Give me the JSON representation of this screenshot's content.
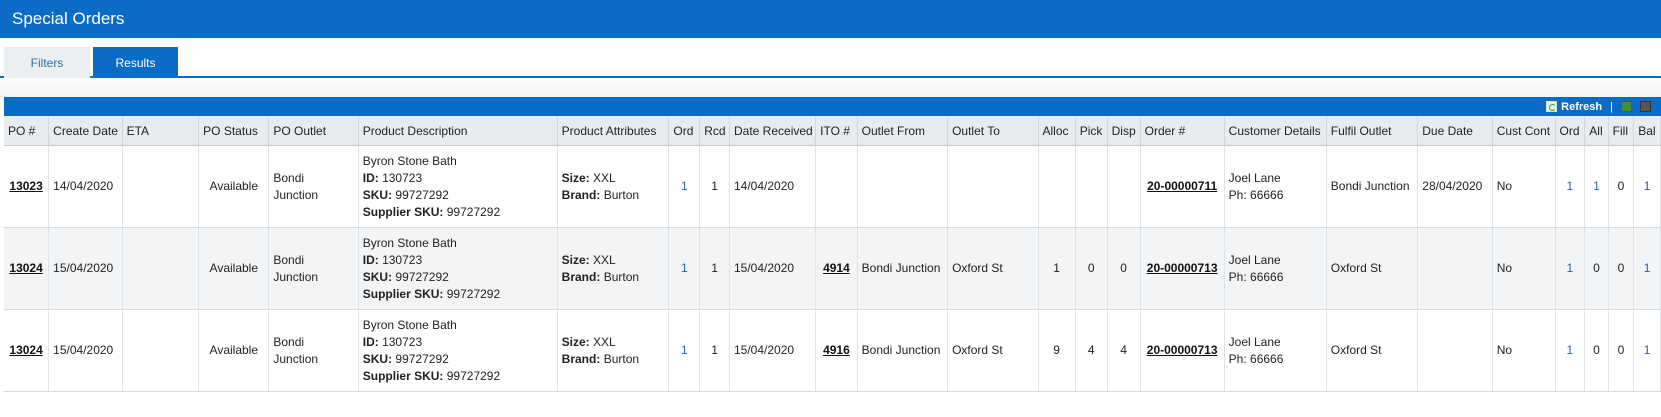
{
  "app": {
    "title": "Special Orders"
  },
  "tabs": {
    "filters": "Filters",
    "results": "Results"
  },
  "toolbar": {
    "refresh": "Refresh",
    "separator": "|"
  },
  "labels": {
    "id": "ID:",
    "sku": "SKU:",
    "supplier_sku": "Supplier SKU:",
    "size": "Size:",
    "brand": "Brand:",
    "phone": "Ph:"
  },
  "columns": [
    "PO #",
    "Create Date",
    "ETA",
    "PO Status",
    "PO Outlet",
    "Product Description",
    "Product Attributes",
    "Ord",
    "Rcd",
    "Date Received",
    "ITO #",
    "Outlet From",
    "Outlet To",
    "Alloc",
    "Pick",
    "Disp",
    "Order #",
    "Customer Details",
    "Fulfil Outlet",
    "Due Date",
    "Cust Cont",
    "Ord",
    "All",
    "Fill",
    "Bal"
  ],
  "rows": [
    {
      "po": "13023",
      "create_date": "14/04/2020",
      "eta": "",
      "po_status": "Available",
      "po_outlet": [
        "Bondi",
        "Junction"
      ],
      "product": {
        "name": "Byron Stone Bath",
        "id": "130723",
        "sku": "99727292",
        "supplier_sku": "99727292"
      },
      "attrs": {
        "size": "XXL",
        "brand": "Burton"
      },
      "ord": "1",
      "rcd": "1",
      "date_received": "14/04/2020",
      "ito": "",
      "outlet_from": "",
      "outlet_to": "",
      "alloc": "",
      "pick": "",
      "disp": "",
      "order": "20-00000711",
      "customer": {
        "name": "Joel Lane",
        "phone": "66666"
      },
      "fulfil_outlet": "Bondi Junction",
      "due_date": "28/04/2020",
      "cust_cont": "No",
      "ord2": "1",
      "all": "1",
      "fill": "0",
      "bal": "1"
    },
    {
      "po": "13024",
      "create_date": "15/04/2020",
      "eta": "",
      "po_status": "Available",
      "po_outlet": [
        "Bondi",
        "Junction"
      ],
      "product": {
        "name": "Byron Stone Bath",
        "id": "130723",
        "sku": "99727292",
        "supplier_sku": "99727292"
      },
      "attrs": {
        "size": "XXL",
        "brand": "Burton"
      },
      "ord": "1",
      "rcd": "1",
      "date_received": "15/04/2020",
      "ito": "4914",
      "outlet_from": "Bondi Junction",
      "outlet_to": "Oxford St",
      "alloc": "1",
      "pick": "0",
      "disp": "0",
      "order": "20-00000713",
      "customer": {
        "name": "Joel Lane",
        "phone": "66666"
      },
      "fulfil_outlet": "Oxford St",
      "due_date": "",
      "cust_cont": "No",
      "ord2": "1",
      "all": "0",
      "fill": "0",
      "bal": "1"
    },
    {
      "po": "13024",
      "create_date": "15/04/2020",
      "eta": "",
      "po_status": "Available",
      "po_outlet": [
        "Bondi",
        "Junction"
      ],
      "product": {
        "name": "Byron Stone Bath",
        "id": "130723",
        "sku": "99727292",
        "supplier_sku": "99727292"
      },
      "attrs": {
        "size": "XXL",
        "brand": "Burton"
      },
      "ord": "1",
      "rcd": "1",
      "date_received": "15/04/2020",
      "ito": "4916",
      "outlet_from": "Bondi Junction",
      "outlet_to": "Oxford St",
      "alloc": "9",
      "pick": "4",
      "disp": "4",
      "order": "20-00000713",
      "customer": {
        "name": "Joel Lane",
        "phone": "66666"
      },
      "fulfil_outlet": "Oxford St",
      "due_date": "",
      "cust_cont": "No",
      "ord2": "1",
      "all": "0",
      "fill": "0",
      "bal": "1"
    }
  ],
  "colors": {
    "primary": "#0a6cc4",
    "link_blue": "#2a63a8",
    "header_bg": "#e9ecef",
    "alt_row": "#f3f4f5"
  }
}
